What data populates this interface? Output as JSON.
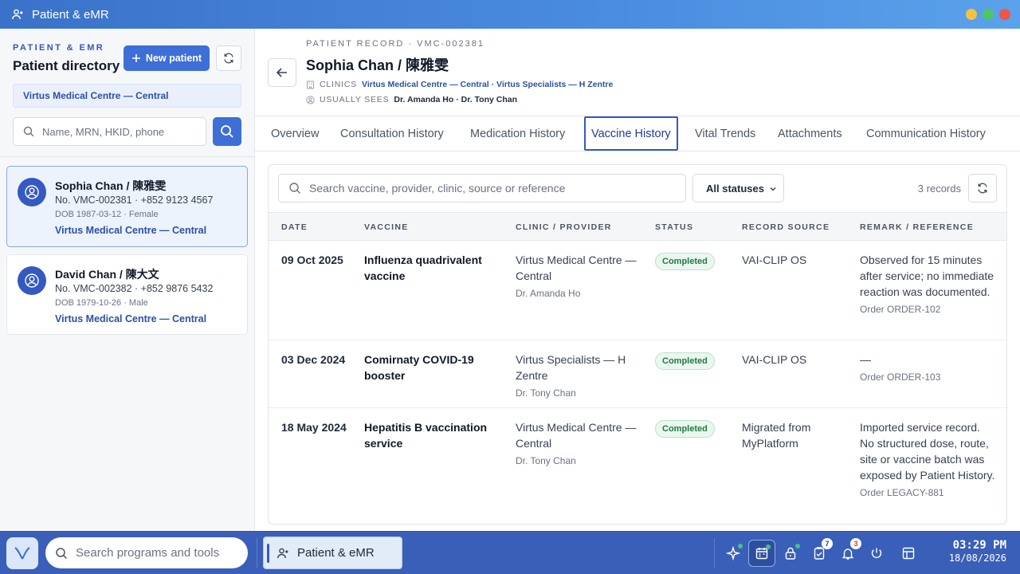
{
  "window": {
    "title": "Patient & eMR",
    "controls": {
      "minimize_color": "#f5c242",
      "maximize_color": "#4cc764",
      "close_color": "#f0554a"
    }
  },
  "sidebar": {
    "eyebrow": "PATIENT & EMR",
    "title": "Patient directory",
    "new_patient_label": "New patient",
    "clinic_filter": "Virtus Medical Centre — Central",
    "search_placeholder": "Name, MRN, HKID, phone",
    "patients": [
      {
        "name": "Sophia Chan / 陳雅雯",
        "line": "No. VMC-002381 · +852 9123 4567",
        "dob": "DOB 1987-03-12 · Female",
        "clinic": "Virtus Medical Centre — Central",
        "selected": true
      },
      {
        "name": "David Chan / 陳大文",
        "line": "No. VMC-002382 · +852 9876 5432",
        "dob": "DOB 1979-10-26 · Male",
        "clinic": "Virtus Medical Centre — Central",
        "selected": false
      }
    ]
  },
  "record": {
    "eyebrow": "PATIENT RECORD · VMC-002381",
    "title": "Sophia Chan / 陳雅雯",
    "clinics_label": "CLINICS",
    "clinics_value": "Virtus Medical Centre — Central · Virtus Specialists — H Zentre",
    "usually_sees_label": "USUALLY SEES",
    "usually_sees_value": "Dr. Amanda Ho · Dr. Tony Chan"
  },
  "tabs": [
    {
      "label": "Overview"
    },
    {
      "label": "Consultation History"
    },
    {
      "label": "Medication History"
    },
    {
      "label": "Vaccine History",
      "active": true
    },
    {
      "label": "Vital Trends"
    },
    {
      "label": "Attachments"
    },
    {
      "label": "Communication History"
    }
  ],
  "vaccines": {
    "search_placeholder": "Search vaccine, provider, clinic, source or reference",
    "status_filter": "All statuses",
    "count": "3 records",
    "columns": [
      "DATE",
      "VACCINE",
      "CLINIC / PROVIDER",
      "STATUS",
      "RECORD SOURCE",
      "REMARK / REFERENCE"
    ],
    "rows": [
      {
        "date": "09 Oct 2025",
        "vaccine": "Influenza quadrivalent vaccine",
        "clinic": "Virtus Medical Centre — Central",
        "provider": "Dr. Amanda Ho",
        "status": "Completed",
        "source": "VAI-CLIP OS",
        "remark": "Observed for 15 minutes after service; no immediate reaction was documented.",
        "order": "Order ORDER-102"
      },
      {
        "date": "03 Dec 2024",
        "vaccine": "Comirnaty COVID-19 booster",
        "clinic": "Virtus Specialists — H Zentre",
        "provider": "Dr. Tony Chan",
        "status": "Completed",
        "source": "VAI-CLIP OS",
        "remark": "—",
        "order": "Order ORDER-103"
      },
      {
        "date": "18 May 2024",
        "vaccine": "Hepatitis B vaccination service",
        "clinic": "Virtus Medical Centre — Central",
        "provider": "Dr. Tony Chan",
        "status": "Completed",
        "source": "Migrated from MyPlatform",
        "remark": "Imported service record. No structured dose, route, site or vaccine batch was exposed by Patient History.",
        "order": "Order LEGACY-881"
      }
    ]
  },
  "taskbar": {
    "search_placeholder": "Search programs and tools",
    "active_app": "Patient & eMR",
    "tasks_count": "7",
    "notifications_count": "3",
    "time": "03:29 PM",
    "date": "18/08/2026"
  }
}
